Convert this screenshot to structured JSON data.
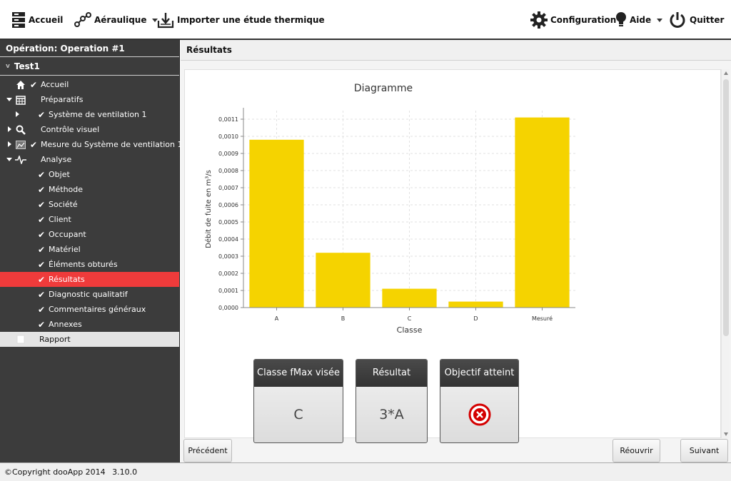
{
  "toolbar": {
    "accueil": "Accueil",
    "aeraulique": "Aéraulique",
    "importer": "Importer une étude thermique",
    "configuration": "Configuration",
    "aide": "Aide",
    "quitter": "Quitter"
  },
  "sidebar": {
    "operation": "Opération: Operation #1",
    "project": "Test1",
    "items": [
      {
        "label": "Accueil"
      },
      {
        "label": "Préparatifs"
      },
      {
        "label": "Système de ventilation 1"
      },
      {
        "label": "Contrôle visuel"
      },
      {
        "label": "Mesure du Système de ventilation 1"
      },
      {
        "label": "Analyse"
      },
      {
        "label": "Objet"
      },
      {
        "label": "Méthode"
      },
      {
        "label": "Société"
      },
      {
        "label": "Client"
      },
      {
        "label": "Occupant"
      },
      {
        "label": "Matériel"
      },
      {
        "label": "Éléments obturés"
      },
      {
        "label": "Résultats"
      },
      {
        "label": "Diagnostic qualitatif"
      },
      {
        "label": "Commentaires généraux"
      },
      {
        "label": "Annexes"
      },
      {
        "label": "Rapport"
      }
    ]
  },
  "content": {
    "title": "Résultats"
  },
  "chart_data": {
    "type": "bar",
    "title": "Diagramme",
    "xlabel": "Classe",
    "ylabel": "Débit de fuite en m³/s",
    "categories": [
      "A",
      "B",
      "C",
      "D",
      "Mesuré"
    ],
    "values": [
      0.00098,
      0.00032,
      0.00011,
      3.5e-05,
      0.00111
    ],
    "ylim": [
      0,
      0.00115
    ],
    "yticks": [
      "0,0000",
      "0,0001",
      "0,0002",
      "0,0003",
      "0,0004",
      "0,0005",
      "0,0006",
      "0,0007",
      "0,0008",
      "0,0009",
      "0,0010",
      "0,0011"
    ],
    "grid": true,
    "bar_color": "#f5d300"
  },
  "cards": [
    {
      "title": "Classe fMax visée",
      "value": "C"
    },
    {
      "title": "Résultat",
      "value": "3*A"
    },
    {
      "title": "Objectif atteint",
      "value": ""
    }
  ],
  "buttons": {
    "precedent": "Précédent",
    "rouvrir": "Réouvrir",
    "suivant": "Suivant"
  },
  "status": {
    "copyright": "©Copyright dooApp 2014",
    "version": "3.10.0"
  }
}
